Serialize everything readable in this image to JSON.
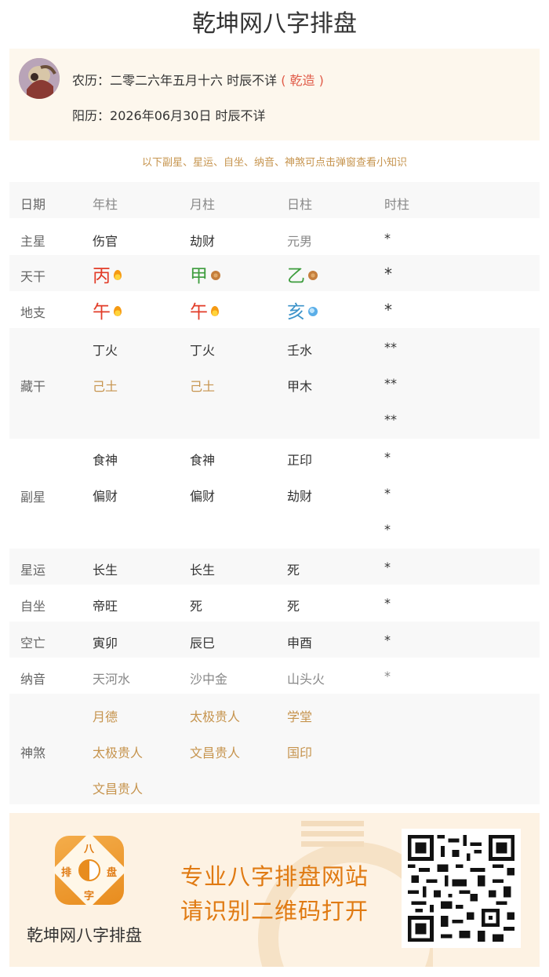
{
  "page": {
    "title": "乾坤网八字排盘"
  },
  "info": {
    "lunar_prefix": "农历：",
    "lunar_date": "二零二六年五月十六 时辰不详",
    "gender": "( 乾造 )",
    "solar_prefix": "阳历：",
    "solar_date": "2026年06月30日 时辰不详"
  },
  "hint": "以下副星、星运、自坐、纳音、神煞可点击弹窗查看小知识",
  "table": {
    "headers": [
      "日期",
      "年柱",
      "月柱",
      "日柱",
      "时柱"
    ],
    "zhuxing": {
      "label": "主星",
      "values": [
        "伤官",
        "劫财",
        "元男",
        "*"
      ]
    },
    "tiangan": {
      "label": "天干",
      "values": [
        "丙",
        "甲",
        "乙",
        "*"
      ],
      "elements": [
        "fire",
        "earth",
        "earth"
      ]
    },
    "dizhi": {
      "label": "地支",
      "values": [
        "午",
        "午",
        "亥",
        "*"
      ],
      "elements": [
        "fire",
        "fire",
        "water"
      ]
    },
    "canggan": {
      "label": "藏干",
      "rows": [
        [
          "丁火",
          "丁火",
          "壬水",
          "**"
        ],
        [
          "己土",
          "己土",
          "甲木",
          "**"
        ],
        [
          "",
          "",
          "",
          "**"
        ]
      ]
    },
    "fuxing": {
      "label": "副星",
      "rows": [
        [
          "食神",
          "食神",
          "正印",
          "*"
        ],
        [
          "偏财",
          "偏财",
          "劫财",
          "*"
        ],
        [
          "",
          "",
          "",
          "*"
        ]
      ]
    },
    "xingyun": {
      "label": "星运",
      "values": [
        "长生",
        "长生",
        "死",
        "*"
      ]
    },
    "zizuo": {
      "label": "自坐",
      "values": [
        "帝旺",
        "死",
        "死",
        "*"
      ]
    },
    "kongwang": {
      "label": "空亡",
      "values": [
        "寅卯",
        "辰巳",
        "申酉",
        "*"
      ]
    },
    "nayin": {
      "label": "纳音",
      "values": [
        "天河水",
        "沙中金",
        "山头火",
        "*"
      ]
    },
    "shensha": {
      "label": "神煞",
      "rows": [
        [
          "月德",
          "太极贵人",
          "学堂"
        ],
        [
          "太极贵人",
          "文昌贵人",
          "国印"
        ],
        [
          "文昌贵人",
          "",
          ""
        ]
      ]
    }
  },
  "footer": {
    "logo_chars": [
      "八",
      "排",
      "盘",
      "字"
    ],
    "app_name": "乾坤网八字排盘",
    "slogan_1": "专业八字排盘网站",
    "slogan_2": "请识别二维码打开"
  },
  "colors": {
    "accent_gold": "#c6944e",
    "fire_red": "#e23c28",
    "wood_green": "#3e9d3e",
    "water_blue": "#3d93c9",
    "brand_orange": "#e07a12"
  }
}
